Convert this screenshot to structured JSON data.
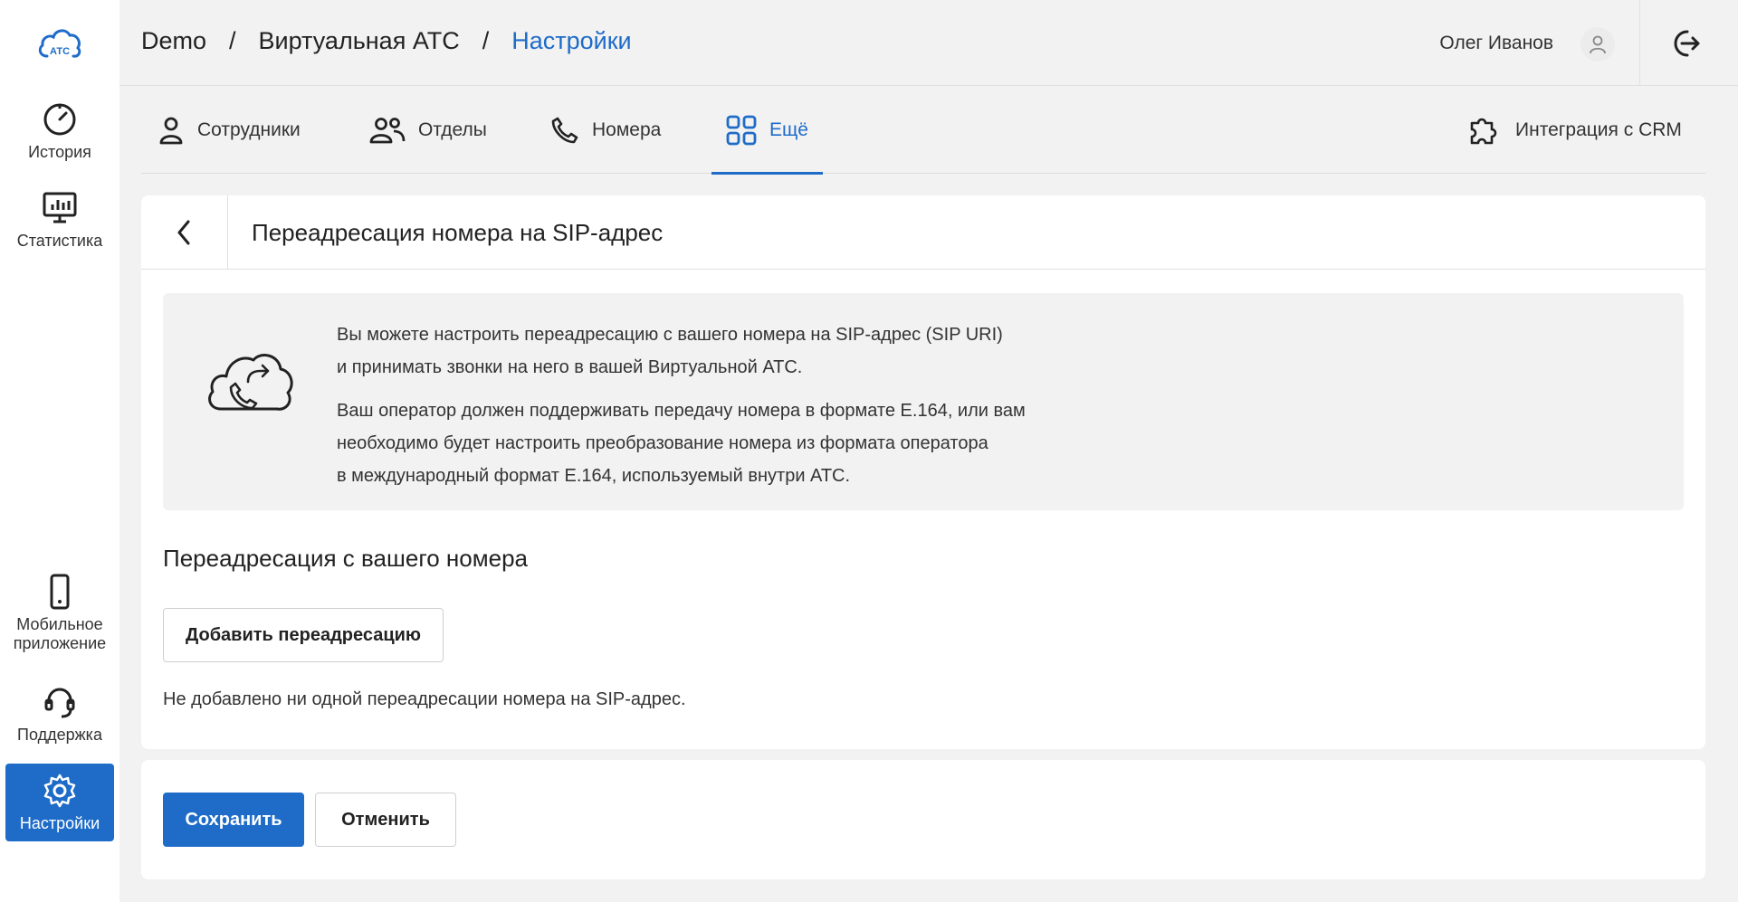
{
  "sidebar": {
    "logo_text": "АТС",
    "items": [
      {
        "label": "История",
        "icon": "clock-icon"
      },
      {
        "label": "Статистика",
        "icon": "chart-monitor-icon"
      },
      {
        "label": "Мобильное приложение",
        "icon": "phone-device-icon"
      },
      {
        "label": "Поддержка",
        "icon": "headset-icon"
      },
      {
        "label": "Настройки",
        "icon": "gear-icon",
        "active": true
      }
    ]
  },
  "header": {
    "breadcrumb": [
      "Demo",
      "Виртуальная АТС",
      "Настройки"
    ],
    "separator": "/",
    "user_name": "Олег Иванов"
  },
  "tabs": [
    {
      "label": "Сотрудники",
      "icon": "user-icon"
    },
    {
      "label": "Отделы",
      "icon": "users-icon"
    },
    {
      "label": "Номера",
      "icon": "phone-icon"
    },
    {
      "label": "Ещё",
      "icon": "grid-icon",
      "active": true
    },
    {
      "label": "Интеграция с CRM",
      "icon": "puzzle-icon"
    }
  ],
  "page": {
    "title": "Переадресация номера на SIP-адрес",
    "info": {
      "p1_line1": "Вы можете настроить переадресацию с вашего номера на SIP-адрес (SIP URI)",
      "p1_line2": "и принимать звонки на него в вашей Виртуальной АТС.",
      "p2_line1": "Ваш оператор должен поддерживать передачу номера в формате E.164, или вам",
      "p2_line2": "необходимо будет настроить преобразование номера из формата оператора",
      "p2_line3": "в международный формат E.164, используемый внутри АТС."
    },
    "section_title": "Переадресация с вашего номера",
    "add_button": "Добавить переадресацию",
    "empty_message": "Не добавлено ни одной переадресации номера на SIP-адрес."
  },
  "footer": {
    "save": "Сохранить",
    "cancel": "Отменить"
  },
  "colors": {
    "accent": "#1e6cc8",
    "background": "#f2f2f2"
  }
}
